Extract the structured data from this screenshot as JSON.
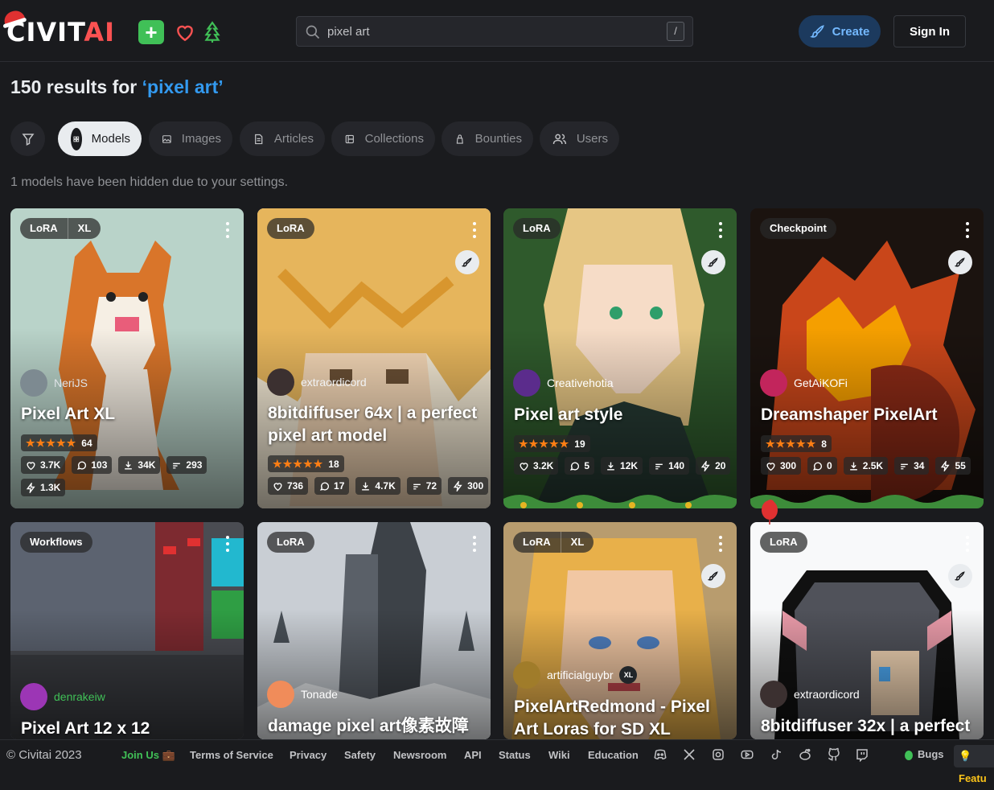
{
  "header": {
    "logo_main": "CIVIT",
    "logo_accent": "AI",
    "search_value": "pixel art",
    "search_shortcut": "/",
    "create_label": "Create",
    "signin_label": "Sign In"
  },
  "results": {
    "prefix": "150 results for ",
    "query": "‘pixel art’"
  },
  "tabs": [
    {
      "label": "Models",
      "active": true
    },
    {
      "label": "Images"
    },
    {
      "label": "Articles"
    },
    {
      "label": "Collections"
    },
    {
      "label": "Bounties"
    },
    {
      "label": "Users"
    }
  ],
  "hidden_message": "1 models have been hidden due to your settings.",
  "cards": [
    {
      "badges": [
        "LoRA",
        "XL"
      ],
      "creator": "NeriJS",
      "title": "Pixel Art XL",
      "rating_count": "64",
      "likes": "3.7K",
      "comments": "103",
      "downloads": "34K",
      "tips": "293",
      "buzz": "1.3K"
    },
    {
      "badges": [
        "LoRA"
      ],
      "creator": "extraordicord",
      "title": "8bitdiffuser 64x | a perfect pixel art model",
      "rating_count": "18",
      "likes": "736",
      "comments": "17",
      "downloads": "4.7K",
      "tips": "72",
      "buzz": "300"
    },
    {
      "badges": [
        "LoRA"
      ],
      "creator": "Creativehotia",
      "title": "Pixel art style",
      "rating_count": "19",
      "likes": "3.2K",
      "comments": "5",
      "downloads": "12K",
      "tips": "140",
      "buzz": "20"
    },
    {
      "badges": [
        "Checkpoint"
      ],
      "creator": "GetAiKOFi",
      "title": "Dreamshaper PixelArt",
      "rating_count": "8",
      "likes": "300",
      "comments": "0",
      "downloads": "2.5K",
      "tips": "34",
      "buzz": "55"
    },
    {
      "badges": [
        "Workflows"
      ],
      "creator": "denrakeiw",
      "title": "Pixel Art 12 x 12"
    },
    {
      "badges": [
        "LoRA"
      ],
      "creator": "Tonade",
      "title": "damage pixel art像素故障"
    },
    {
      "badges": [
        "LoRA",
        "XL"
      ],
      "creator": "artificialguybr",
      "creator_badge": "XL",
      "title": "PixelArtRedmond - Pixel Art Loras for SD XL"
    },
    {
      "badges": [
        "LoRA"
      ],
      "creator": "extraordicord",
      "title": "8bitdiffuser 32x | a perfect"
    }
  ],
  "footer": {
    "copyright": "© Civitai 2023",
    "join": "Join Us 💼",
    "links": [
      "Terms of Service",
      "Privacy",
      "Safety",
      "Newsroom",
      "API",
      "Status",
      "Wiki",
      "Education"
    ],
    "bugs": "Bugs",
    "feature": "💡 Featu"
  },
  "colors": {
    "accent": "#339af0",
    "brand_red": "#fa5252",
    "star": "#fd7e14",
    "background": "#1a1b1e"
  },
  "icons": [
    "search-icon",
    "plus-icon",
    "heart-icon",
    "tree-icon",
    "brush-icon",
    "filter-icon",
    "grid-icon",
    "image-icon",
    "article-icon",
    "collection-icon",
    "bounty-icon",
    "users-icon",
    "dots-icon",
    "like-icon",
    "comment-icon",
    "download-icon",
    "tip-icon",
    "bolt-icon",
    "discord-icon",
    "x-icon",
    "instagram-icon",
    "youtube-icon",
    "tiktok-icon",
    "reddit-icon",
    "github-icon",
    "twitch-icon",
    "bug-icon"
  ]
}
